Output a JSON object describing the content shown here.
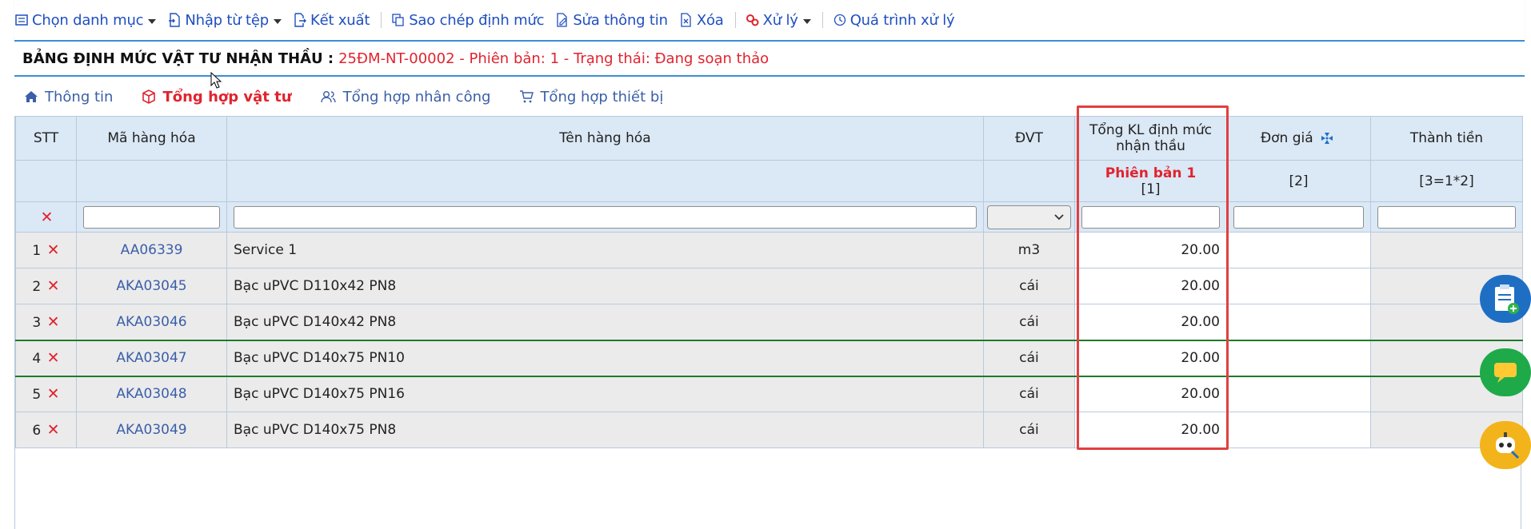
{
  "toolbar": {
    "items": [
      {
        "label": "Chọn danh mục",
        "icon": "list-icon",
        "caret": true
      },
      {
        "label": "Nhập từ tệp",
        "icon": "import-icon",
        "caret": true
      },
      {
        "label": "Kết xuất",
        "icon": "export-icon",
        "caret": false
      },
      {
        "label": "Sao chép định mức",
        "icon": "copy-icon",
        "caret": false
      },
      {
        "label": "Sửa thông tin",
        "icon": "edit-icon",
        "caret": false
      },
      {
        "label": "Xóa",
        "icon": "delete-file-icon",
        "caret": false
      },
      {
        "label": "Xử lý",
        "icon": "gears-icon",
        "caret": true
      },
      {
        "label": "Quá trình xử lý",
        "icon": "clock-icon",
        "caret": false
      }
    ]
  },
  "title": {
    "label": "BẢNG ĐỊNH MỨC VẬT TƯ NHẬN THẦU :",
    "info": "25ĐM-NT-00002 - Phiên bản: 1 - Trạng thái: Đang soạn thảo"
  },
  "tabs": [
    {
      "label": "Thông tin",
      "icon": "home-icon",
      "active": false
    },
    {
      "label": "Tổng hợp vật tư",
      "icon": "box-icon",
      "active": true
    },
    {
      "label": "Tổng hợp nhân công",
      "icon": "users-icon",
      "active": false
    },
    {
      "label": "Tổng hợp thiết bị",
      "icon": "cart-icon",
      "active": false
    }
  ],
  "grid": {
    "headers": {
      "stt": "STT",
      "code": "Mã hàng hóa",
      "name": "Tên hàng hóa",
      "unit": "ĐVT",
      "qty": "Tổng KL định mức nhận thầu",
      "price": "Đơn giá",
      "amount": "Thành tiền"
    },
    "subheaders": {
      "qty_version": "Phiên bản 1",
      "qty_ref": "[1]",
      "price_ref": "[2]",
      "amount_ref": "[3=1*2]"
    },
    "rows": [
      {
        "stt": "1",
        "code": "AA06339",
        "name": "Service 1",
        "unit": "m3",
        "qty": "20.00"
      },
      {
        "stt": "2",
        "code": "AKA03045",
        "name": "Bạc uPVC D110x42 PN8",
        "unit": "cái",
        "qty": "20.00"
      },
      {
        "stt": "3",
        "code": "AKA03046",
        "name": "Bạc uPVC D140x42 PN8",
        "unit": "cái",
        "qty": "20.00"
      },
      {
        "stt": "4",
        "code": "AKA03047",
        "name": "Bạc uPVC D140x75 PN10",
        "unit": "cái",
        "qty": "20.00"
      },
      {
        "stt": "5",
        "code": "AKA03048",
        "name": "Bạc uPVC D140x75 PN16",
        "unit": "cái",
        "qty": "20.00"
      },
      {
        "stt": "6",
        "code": "AKA03049",
        "name": "Bạc uPVC D140x75 PN8",
        "unit": "cái",
        "qty": "20.00"
      }
    ],
    "selected_row": 4
  },
  "colors": {
    "accent": "#3b8fd6",
    "danger": "#e0242f",
    "header_bg": "#dbe8f5",
    "row_bg": "#ebebeb"
  },
  "floating": [
    {
      "icon": "clipboard-add-icon",
      "color": "#1e6fc4"
    },
    {
      "icon": "chat-icon",
      "color": "#1faa4a"
    },
    {
      "icon": "robot-support-icon",
      "color": "#f3b41b"
    }
  ]
}
